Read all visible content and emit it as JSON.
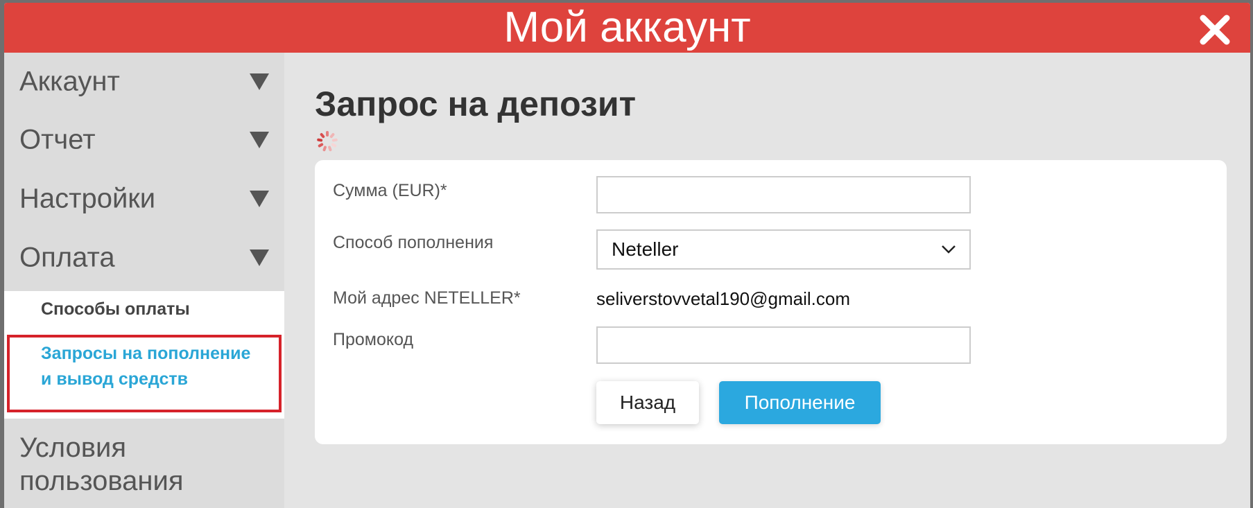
{
  "window": {
    "title": "Мой аккаунт"
  },
  "sidebar": {
    "items": [
      {
        "label": "Аккаунт"
      },
      {
        "label": "Отчет"
      },
      {
        "label": "Настройки"
      },
      {
        "label": "Оплата"
      }
    ],
    "submenu": {
      "items": [
        {
          "label": "Способы оплаты"
        },
        {
          "label": "Запросы на пополнение и вывод средств"
        }
      ]
    },
    "terms": {
      "label": "Условия пользования"
    }
  },
  "main": {
    "title": "Запрос на депозит",
    "form": {
      "amount_label": "Сумма (EUR)*",
      "amount_value": "",
      "method_label": "Способ пополнения",
      "method_value": "Neteller",
      "address_label": "Мой адрес NETELLER*",
      "address_value": "seliverstovvetal190@gmail.com",
      "promo_label": "Промокод",
      "promo_value": "",
      "back_button": "Назад",
      "deposit_button": "Пополнение"
    }
  },
  "colors": {
    "titlebar": "#de433d",
    "accent": "#2ba8df",
    "active_link": "#2aa6d6",
    "highlight": "#d6222a"
  },
  "icons": {
    "close": "close-icon",
    "dropdown": "chevron-down-icon",
    "loading": "loading-spinner-icon",
    "expand": "triangle-down-icon"
  }
}
